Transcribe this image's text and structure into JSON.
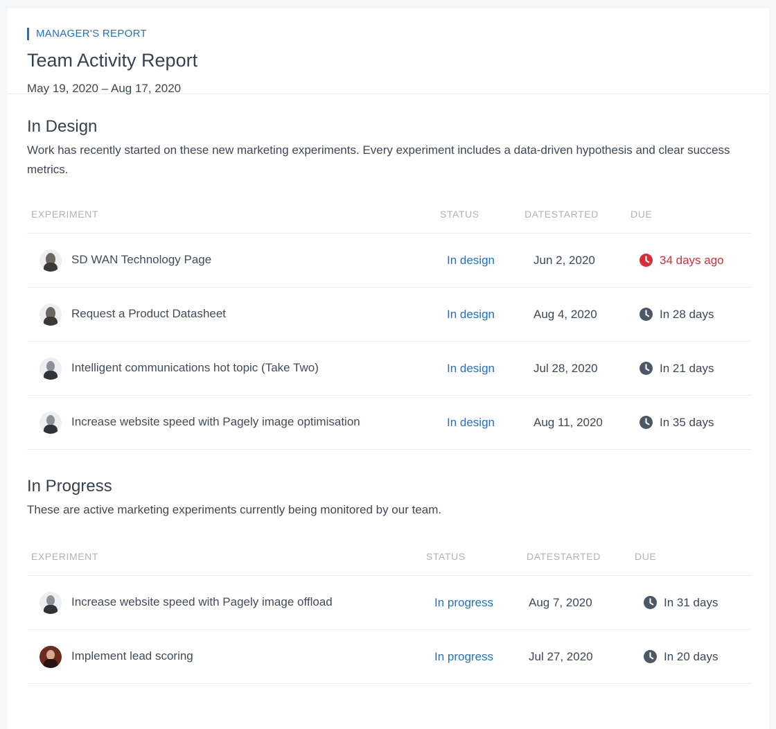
{
  "header": {
    "eyebrow": "MANAGER'S REPORT",
    "title": "Team Activity Report",
    "date_range": "May 19, 2020 – Aug 17, 2020"
  },
  "colors": {
    "accent": "#1f6fd1",
    "overdue": "#d92d3a",
    "muted": "#a9b4be"
  },
  "sections": [
    {
      "title": "In Design",
      "description": "Work has recently started on these new marketing experiments. Every experiment includes a data-driven hypothesis and clear success metrics.",
      "columns": [
        "EXPERIMENT",
        "STATUS",
        "DATESTARTED",
        "DUE"
      ],
      "rows": [
        {
          "avatar": "avatar-long-hair",
          "name": "SD WAN Technology Page",
          "status": "In design",
          "date": "Jun 2, 2020",
          "due": "34 days ago",
          "overdue": true
        },
        {
          "avatar": "avatar-long-hair",
          "name": "Request a Product Datasheet",
          "status": "In design",
          "date": "Aug 4, 2020",
          "due": "In 28 days",
          "overdue": false
        },
        {
          "avatar": "avatar-bald",
          "name": "Intelligent communications hot topic (Take Two)",
          "status": "In design",
          "date": "Jul 28, 2020",
          "due": "In 21 days",
          "overdue": false
        },
        {
          "avatar": "avatar-bald",
          "name": "Increase website speed with Pagely image optimisation",
          "status": "In design",
          "date": "Aug 11, 2020",
          "due": "In 35 days",
          "overdue": false
        }
      ]
    },
    {
      "title": "In Progress",
      "description": "These are active marketing experiments currently being monitored by our team.",
      "columns": [
        "EXPERIMENT",
        "STATUS",
        "DATESTARTED",
        "DUE"
      ],
      "rows": [
        {
          "avatar": "avatar-bald",
          "name": "Increase website speed with Pagely image offload",
          "status": "In progress",
          "date": "Aug 7, 2020",
          "due": "In 31 days",
          "overdue": false
        },
        {
          "avatar": "avatar-woman",
          "name": "Implement lead scoring",
          "status": "In progress",
          "date": "Jul 27, 2020",
          "due": "In 20 days",
          "overdue": false
        }
      ]
    }
  ]
}
